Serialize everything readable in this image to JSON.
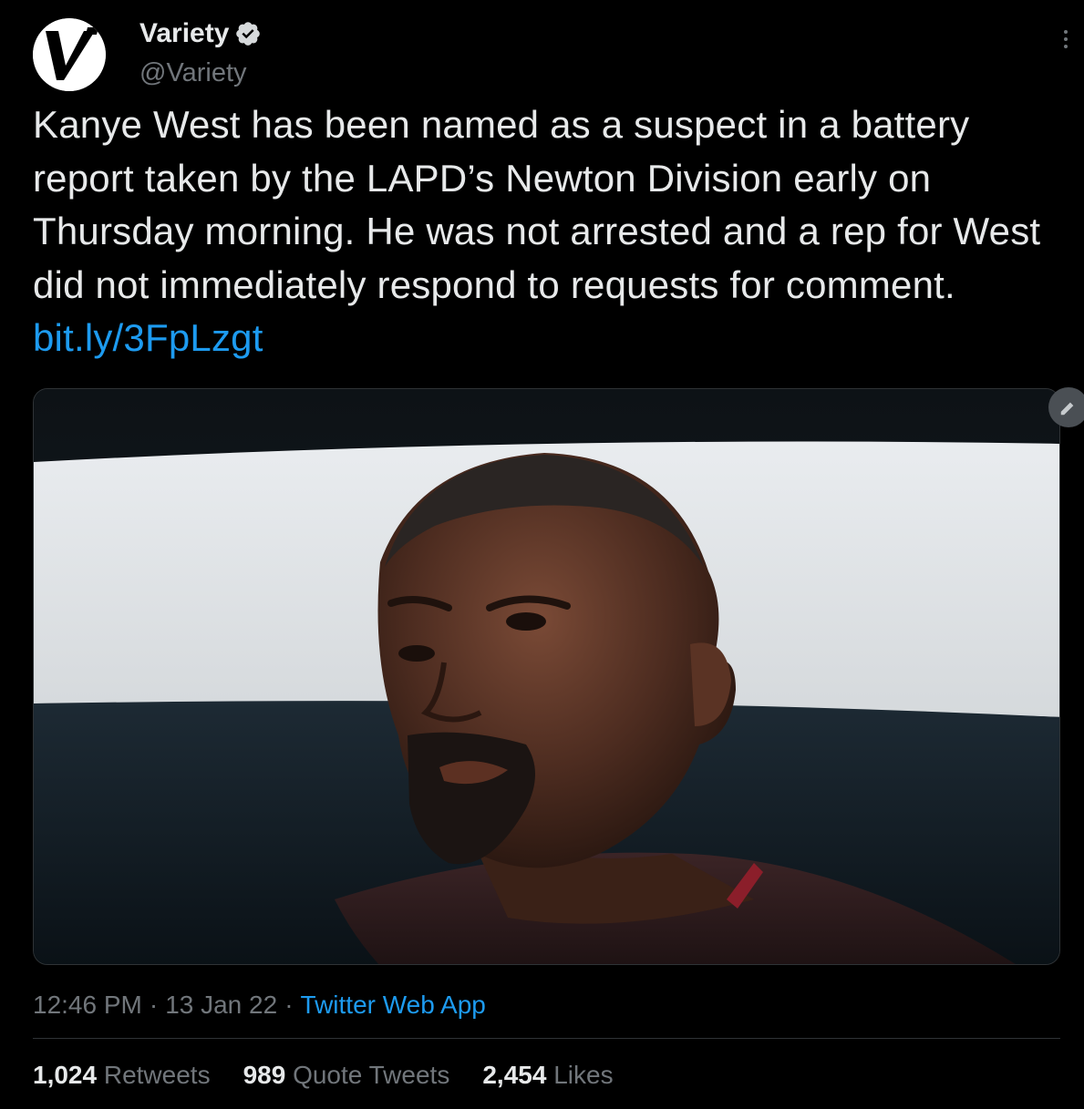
{
  "author": {
    "name": "Variety",
    "handle": "@Variety",
    "avatar_letter": "V"
  },
  "tweet": {
    "text": "Kanye West has been named as a suspect in a battery report taken by the LAPD’s Newton Division early on Thursday morning. He was not arrested and a rep for West did not immediately respond to requests for comment. ",
    "link": "bit.ly/3FpLzgt"
  },
  "meta": {
    "time": "12:46 PM",
    "separator": "·",
    "date": "13 Jan 22",
    "source": "Twitter Web App"
  },
  "stats": {
    "retweets_count": "1,024",
    "retweets_label": "Retweets",
    "quotes_count": "989",
    "quotes_label": "Quote Tweets",
    "likes_count": "2,454",
    "likes_label": "Likes"
  },
  "icons": {
    "verified": "verified-badge-icon",
    "more": "more-options-icon",
    "edit": "edit-icon"
  },
  "colors": {
    "background": "#000000",
    "text": "#e7e9ea",
    "secondary": "#71767b",
    "link": "#1d9bf0",
    "divider": "#2f3336"
  }
}
